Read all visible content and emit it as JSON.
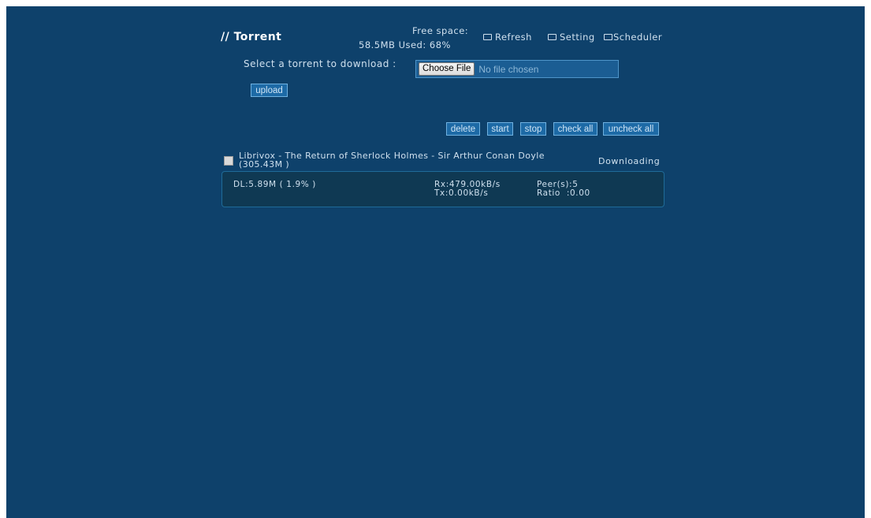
{
  "header": {
    "title": "// Torrent",
    "free_space_label": "Free space:",
    "free_space_value": "58.5MB",
    "used_label": "Used: 68%",
    "links": {
      "refresh": "Refresh",
      "setting": "Setting",
      "scheduler": "Scheduler"
    }
  },
  "upload": {
    "select_label": "Select a torrent to download :",
    "choose_file_label": "Choose File",
    "no_file_text": "No file chosen",
    "upload_button": "upload"
  },
  "actions": {
    "delete": "delete",
    "start": "start",
    "stop": "stop",
    "check_all": "check all",
    "uncheck_all": "uncheck all"
  },
  "torrents": [
    {
      "name": "Librivox - The Return of Sherlock Holmes - Sir Arthur Conan Doyle",
      "size": "(305.43M )",
      "status": "Downloading",
      "downloaded": "DL:5.89M ( 1.9% )",
      "rx": "Rx:479.00kB/s",
      "tx": "Tx:0.00kB/s",
      "peers": "Peer(s):5",
      "ratio": "Ratio  :0.00",
      "checked": false
    }
  ],
  "colors": {
    "page_background": "#0e416b",
    "button_background": "#1d6aa6",
    "button_border": "#6fb1e0",
    "detail_background": "#0f3953",
    "text": "#cfe0ee"
  }
}
